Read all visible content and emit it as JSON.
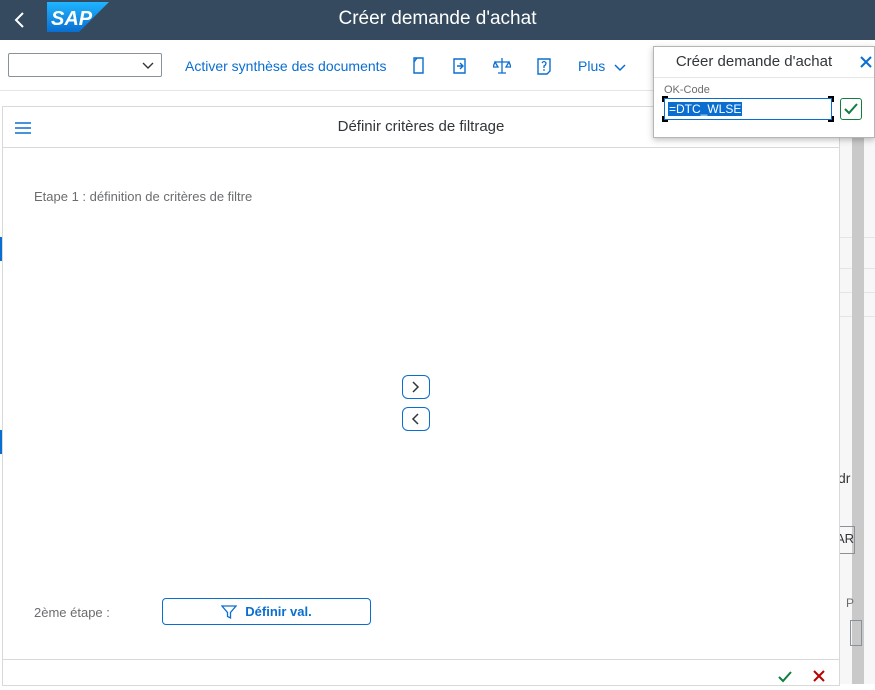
{
  "shell": {
    "title": "Créer demande d'achat",
    "logo_text": "SAP",
    "colors": {
      "header_bg": "#354a5f",
      "logo_blue": "#0a6ed1"
    }
  },
  "toolbar": {
    "command_field_value": "",
    "activer_label": "Activer synthèse des documents",
    "plus_label": "Plus",
    "icons": [
      "document-icon",
      "export-icon",
      "balance-icon",
      "help-document-icon"
    ]
  },
  "background": {
    "partial_text_1": "dr",
    "partial_text_2": "AR",
    "partial_text_3": "P"
  },
  "dialog": {
    "title": "Définir critères de filtrage",
    "step1_label": "Etape 1 : définition de critères de filtre",
    "step2_label": "2ème étape :",
    "definir_button_label": "Définir val.",
    "nav_buttons": [
      "chevron-right-icon",
      "chevron-left-icon"
    ]
  },
  "popup": {
    "title": "Créer demande d'achat",
    "okcode_label": "OK-Code",
    "okcode_value": "=DTC_WLSE"
  }
}
